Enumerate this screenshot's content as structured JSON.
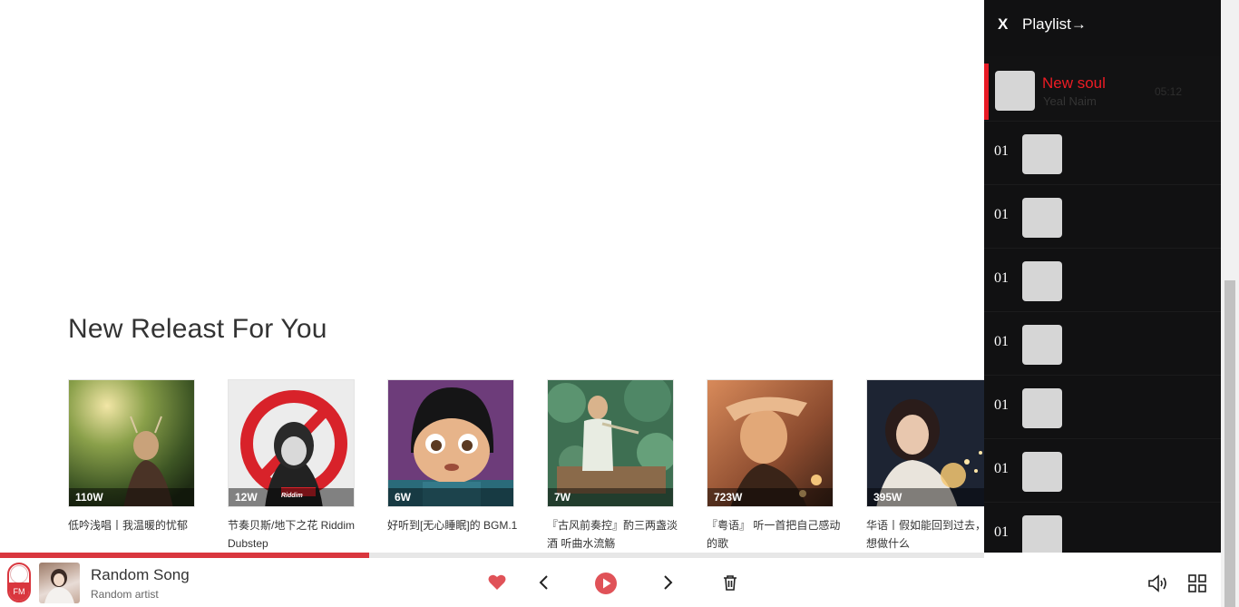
{
  "main": {
    "section_title": "New Releast For You",
    "cards": [
      {
        "count": "110W",
        "title": "低吟浅唱丨我温暖的忧郁"
      },
      {
        "count": "12W",
        "title": "节奏贝斯/地下之花 Riddim Dubstep",
        "badge": "Riddim"
      },
      {
        "count": "6W",
        "title": "好听到[无心睡眠]的 BGM.1"
      },
      {
        "count": "7W",
        "title": "『古风前奏控』酌三两盏淡酒 听曲水流觞"
      },
      {
        "count": "723W",
        "title": "『粤语』 听一首把自己感动的歌"
      },
      {
        "count": "395W",
        "title": "华语丨假如能回到过去，你想做什么"
      }
    ]
  },
  "player": {
    "progress": 0.375,
    "fm_label": "FM",
    "song_title": "Random Song",
    "song_artist": "Random artist",
    "accent": "#d9363e"
  },
  "playlist": {
    "close_label": "X",
    "title": "Playlist→",
    "current": {
      "title": "New soul",
      "artist": "Yeal Naim",
      "duration": "05:12"
    },
    "items": [
      {
        "number": "01"
      },
      {
        "number": "01"
      },
      {
        "number": "01"
      },
      {
        "number": "01"
      },
      {
        "number": "01"
      },
      {
        "number": "01"
      },
      {
        "number": "01"
      }
    ]
  }
}
